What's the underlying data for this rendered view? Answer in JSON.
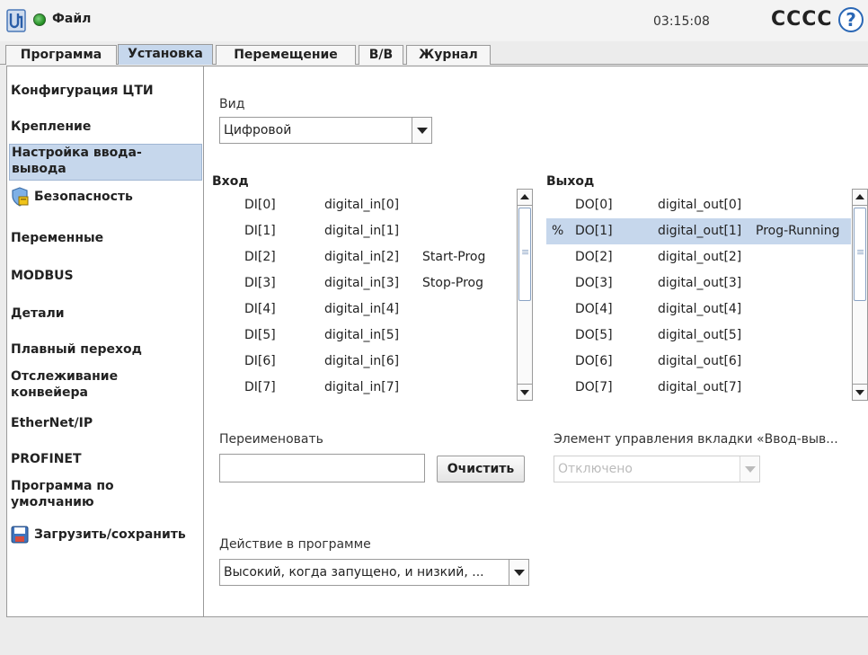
{
  "header": {
    "file_label": "Файл",
    "clock": "03:15:08",
    "robot_name": "CCCC",
    "help": "?"
  },
  "tabs": [
    {
      "label": "Программа",
      "active": false
    },
    {
      "label": "Установка",
      "active": true
    },
    {
      "label": "Перемещение",
      "active": false
    },
    {
      "label": "В/В",
      "active": false
    },
    {
      "label": "Журнал",
      "active": false
    }
  ],
  "sidebar": {
    "items": [
      {
        "label": "Конфигурация ЦТИ"
      },
      {
        "label": "Крепление"
      },
      {
        "label": "Настройка ввода-\nвывода",
        "active": true
      },
      {
        "label": "Безопасность",
        "icon": "shield-icon"
      },
      {
        "label": "Переменные"
      },
      {
        "label": "MODBUS"
      },
      {
        "label": "Детали"
      },
      {
        "label": "Плавный переход"
      },
      {
        "label": "Отслеживание\nконвейера"
      },
      {
        "label": "EtherNet/IP"
      },
      {
        "label": "PROFINET"
      },
      {
        "label": "Программа по\nумолчанию"
      },
      {
        "label": "Загрузить/сохранить",
        "icon": "disk-icon"
      }
    ]
  },
  "view": {
    "label": "Вид",
    "selected": "Цифровой"
  },
  "inputs": {
    "header": "Вход",
    "rows": [
      {
        "id": "DI[0]",
        "name": "digital_in[0]",
        "func": ""
      },
      {
        "id": "DI[1]",
        "name": "digital_in[1]",
        "func": ""
      },
      {
        "id": "DI[2]",
        "name": "digital_in[2]",
        "func": "Start-Prog"
      },
      {
        "id": "DI[3]",
        "name": "digital_in[3]",
        "func": "Stop-Prog"
      },
      {
        "id": "DI[4]",
        "name": "digital_in[4]",
        "func": ""
      },
      {
        "id": "DI[5]",
        "name": "digital_in[5]",
        "func": ""
      },
      {
        "id": "DI[6]",
        "name": "digital_in[6]",
        "func": ""
      },
      {
        "id": "DI[7]",
        "name": "digital_in[7]",
        "func": ""
      }
    ]
  },
  "outputs": {
    "header": "Выход",
    "rows": [
      {
        "mark": "",
        "id": "DO[0]",
        "name": "digital_out[0]",
        "func": ""
      },
      {
        "mark": "%",
        "id": "DO[1]",
        "name": "digital_out[1]",
        "func": "Prog-Running",
        "selected": true
      },
      {
        "mark": "",
        "id": "DO[2]",
        "name": "digital_out[2]",
        "func": ""
      },
      {
        "mark": "",
        "id": "DO[3]",
        "name": "digital_out[3]",
        "func": ""
      },
      {
        "mark": "",
        "id": "DO[4]",
        "name": "digital_out[4]",
        "func": ""
      },
      {
        "mark": "",
        "id": "DO[5]",
        "name": "digital_out[5]",
        "func": ""
      },
      {
        "mark": "",
        "id": "DO[6]",
        "name": "digital_out[6]",
        "func": ""
      },
      {
        "mark": "",
        "id": "DO[7]",
        "name": "digital_out[7]",
        "func": ""
      }
    ]
  },
  "rename": {
    "label": "Переименовать",
    "value": "",
    "clear_button": "Очистить"
  },
  "tab_control": {
    "label": "Элемент управления вкладки «Ввод-выв...",
    "selected": "Отключено"
  },
  "program_action": {
    "label": "Действие в программе",
    "selected": "Высокий, когда запущено, и низкий, ..."
  },
  "colors": {
    "selection": "#c6d7ec",
    "help_blue": "#2a67b5",
    "status_green": "#1c8a1c"
  }
}
